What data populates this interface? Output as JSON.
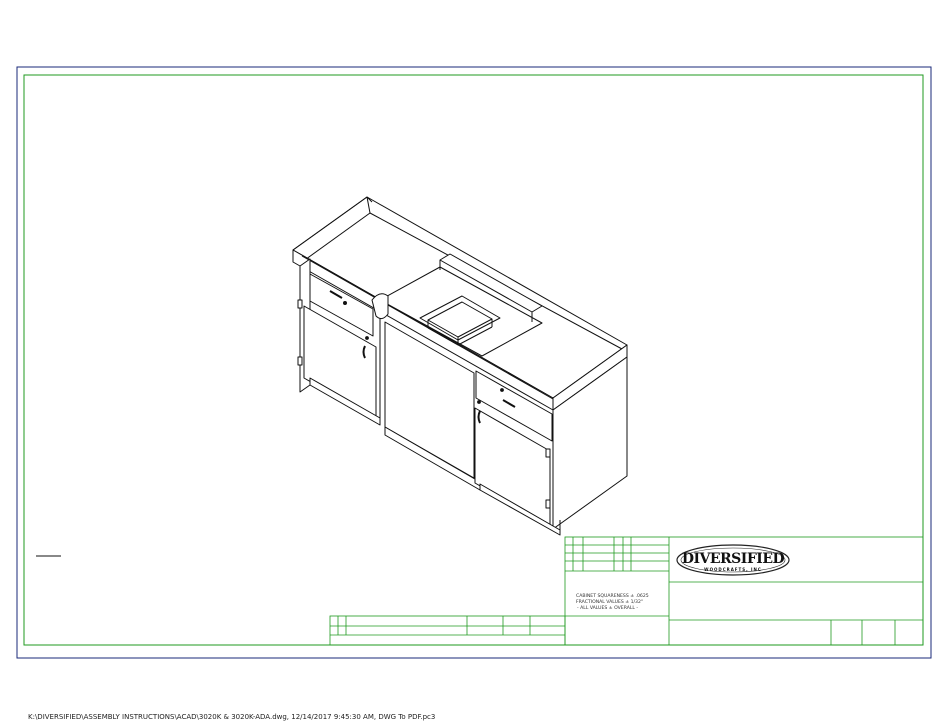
{
  "title_block": {
    "notes": [
      "CABINET SQUARENESS ± .0625",
      "FRACTIONAL VALUES ± 1/32\"",
      "- ALL VALUES ± OVERALL -"
    ],
    "logo_text": "DIVERSIFIED",
    "logo_subtext": "WOODCRAFTS, INC"
  },
  "footer": {
    "path_text": "K:\\DIVERSIFIED\\ASSEMBLY INSTRUCTIONS\\ACAD\\3020K & 3020K-ADA.dwg, 12/14/2017 9:45:30 AM, DWG To PDF.pc3"
  },
  "colors": {
    "outer_border": "#1a2a7a",
    "inner_border": "#1f9a1f",
    "drawing_line": "#111111"
  }
}
